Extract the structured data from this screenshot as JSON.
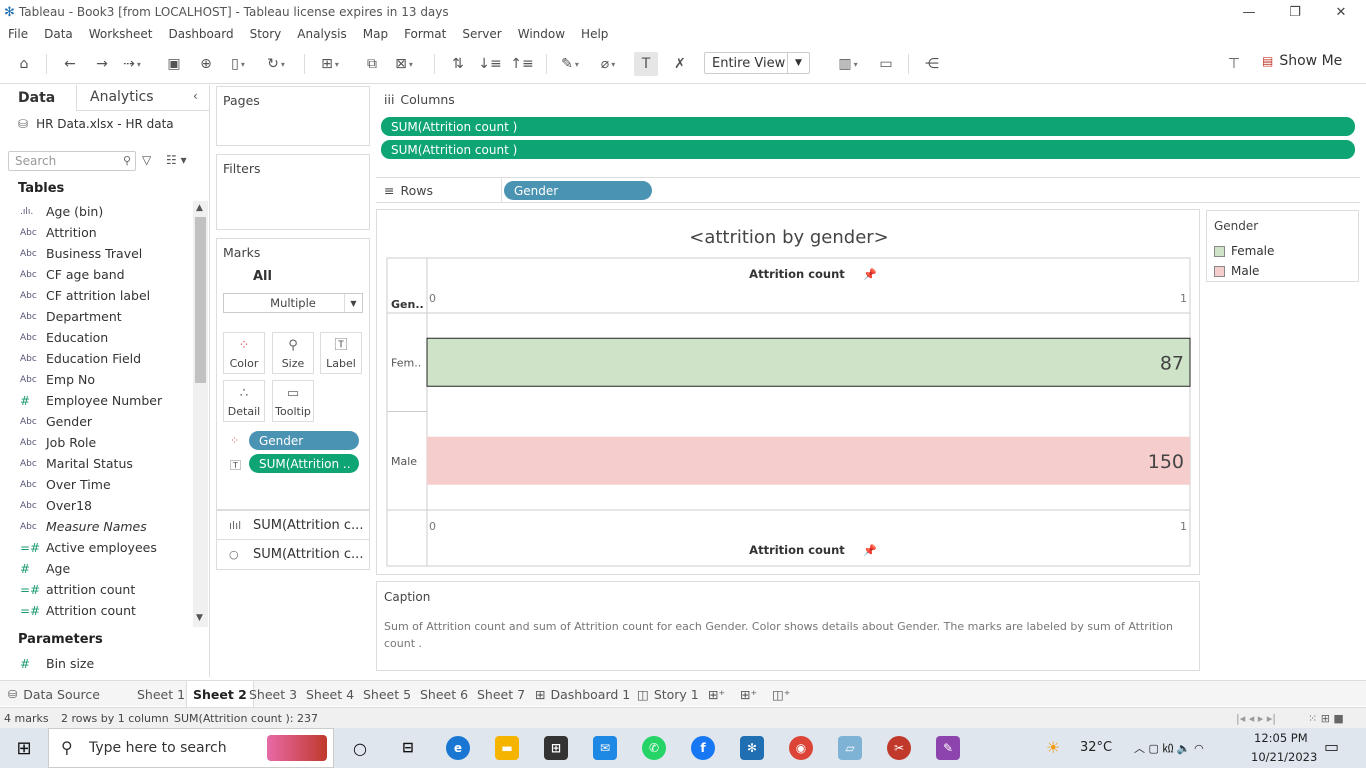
{
  "window": {
    "title": "Tableau - Book3 [from LOCALHOST] - Tableau license expires in 13 days",
    "minimize": "—",
    "restore": "❐",
    "close": "✕"
  },
  "menu": [
    "File",
    "Data",
    "Worksheet",
    "Dashboard",
    "Story",
    "Analysis",
    "Map",
    "Format",
    "Server",
    "Window",
    "Help"
  ],
  "toolbar": {
    "fit_select": "Entire View",
    "show_me": "Show Me"
  },
  "data_pane": {
    "tab_data": "Data",
    "tab_analytics": "Analytics",
    "datasource": "HR Data.xlsx - HR data",
    "search_placeholder": "Search",
    "tables_heading": "Tables",
    "fields": [
      {
        "type": ".ılı.",
        "name": "Age (bin)"
      },
      {
        "type": "Abc",
        "name": "Attrition"
      },
      {
        "type": "Abc",
        "name": "Business Travel"
      },
      {
        "type": "Abc",
        "name": "CF age band"
      },
      {
        "type": "Abc",
        "name": "CF attrition label"
      },
      {
        "type": "Abc",
        "name": "Department"
      },
      {
        "type": "Abc",
        "name": "Education"
      },
      {
        "type": "Abc",
        "name": "Education Field"
      },
      {
        "type": "Abc",
        "name": "Emp No"
      },
      {
        "type": "#",
        "name": "Employee Number"
      },
      {
        "type": "Abc",
        "name": "Gender"
      },
      {
        "type": "Abc",
        "name": "Job Role"
      },
      {
        "type": "Abc",
        "name": "Marital Status"
      },
      {
        "type": "Abc",
        "name": "Over Time"
      },
      {
        "type": "Abc",
        "name": "Over18"
      },
      {
        "type": "Abc",
        "name": "Measure Names"
      },
      {
        "type": "=#",
        "name": "Active employees"
      },
      {
        "type": "#",
        "name": "Age"
      },
      {
        "type": "=#",
        "name": "attrition count"
      },
      {
        "type": "=#",
        "name": "Attrition count"
      }
    ],
    "parameters_heading": "Parameters",
    "parameters": [
      {
        "type": "#",
        "name": "Bin size"
      }
    ]
  },
  "pages": {
    "title": "Pages"
  },
  "filters": {
    "title": "Filters"
  },
  "marks": {
    "title": "Marks",
    "all_label": "All",
    "mark_type": "Multiple",
    "buttons": [
      "Color",
      "Size",
      "Label",
      "Detail",
      "Tooltip"
    ],
    "pills": [
      "Gender",
      "SUM(Attrition .."
    ],
    "measures": [
      "SUM(Attrition c...",
      "SUM(Attrition c..."
    ]
  },
  "columns_shelf": {
    "label": "Columns",
    "pills": [
      "SUM(Attrition count )",
      "SUM(Attrition count )"
    ]
  },
  "rows_shelf": {
    "label": "Rows",
    "pills": [
      "Gender"
    ]
  },
  "legend": {
    "title": "Gender",
    "items": [
      {
        "name": "Female",
        "color": "#cfe3c8"
      },
      {
        "name": "Male",
        "color": "#f6cdcd"
      }
    ]
  },
  "chart_data": {
    "type": "bar",
    "title": "<attrition by gender>",
    "row_header": "Gen..",
    "categories": [
      "Female",
      "Male"
    ],
    "category_labels": [
      "Fem..",
      "Male"
    ],
    "values": [
      87,
      150
    ],
    "colors": [
      "#cfe3c8",
      "#f6cdcd"
    ],
    "xlabel": "Attrition count",
    "xlim": [
      0,
      1
    ],
    "x_ticks": [
      "0",
      "1"
    ],
    "orientation": "horizontal"
  },
  "caption": {
    "title": "Caption",
    "text": "Sum of Attrition count  and sum of Attrition count  for each Gender.  Color shows details about Gender.  The marks are labeled by sum of Attrition count ."
  },
  "sheet_tabs": [
    "Data Source",
    "Sheet 1",
    "Sheet 2",
    "Sheet 3",
    "Sheet 4",
    "Sheet 5",
    "Sheet 6",
    "Sheet 7",
    "Dashboard 1",
    "Story 1"
  ],
  "active_tab": "Sheet 2",
  "status": {
    "marks": "4 marks",
    "dims": "2 rows by 1 column",
    "sum": "SUM(Attrition count ): 237"
  },
  "taskbar": {
    "search_placeholder": "Type here to search",
    "weather": "32°C",
    "time": "12:05 PM",
    "date": "10/21/2023"
  }
}
